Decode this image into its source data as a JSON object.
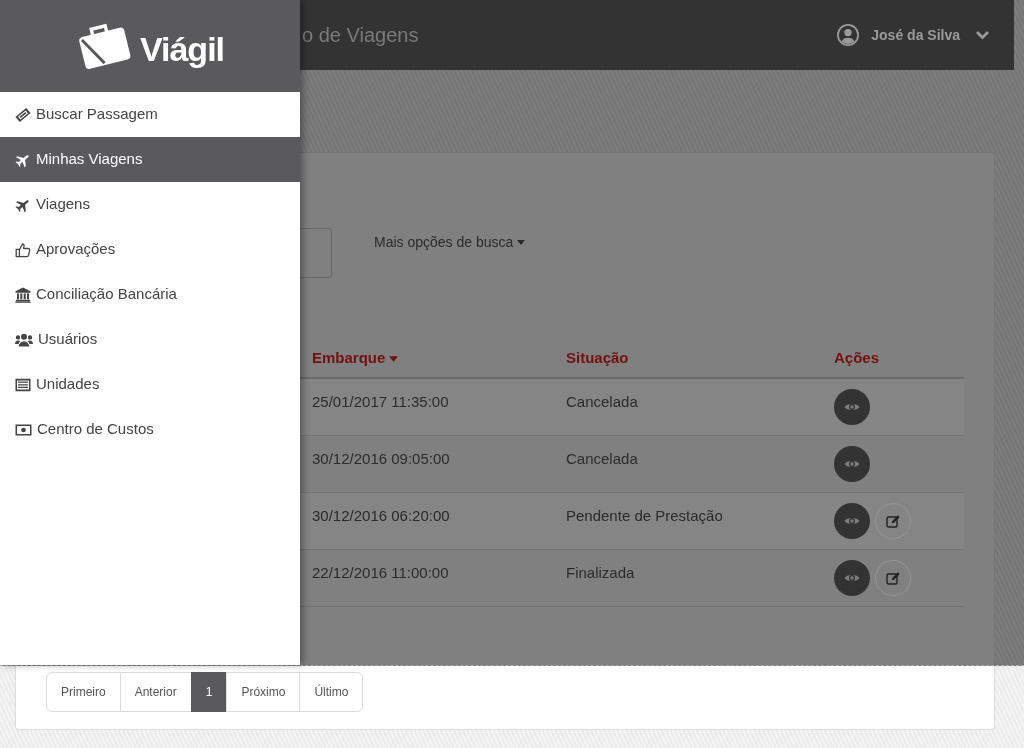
{
  "header": {
    "title": "o de Viagens",
    "user_name": "José da Silva"
  },
  "sidebar": {
    "logo": "Viágil",
    "items": [
      {
        "label": "Buscar Passagem",
        "selected": false
      },
      {
        "label": "Minhas Viagens",
        "selected": true
      },
      {
        "label": "Viagens",
        "selected": false
      },
      {
        "label": "Aprovações",
        "selected": false
      },
      {
        "label": "Conciliação Bancária",
        "selected": false
      },
      {
        "label": "Usuários",
        "selected": false
      },
      {
        "label": "Unidades",
        "selected": false
      },
      {
        "label": "Centro de Custos",
        "selected": false
      }
    ]
  },
  "search": {
    "more_options": "Mais opções de busca"
  },
  "table": {
    "columns": [
      {
        "label": "Embarque",
        "sorted": true
      },
      {
        "label": "Situação",
        "sorted": false
      },
      {
        "label": "Ações",
        "sorted": false
      }
    ],
    "rows": [
      {
        "embarque": "25/01/2017 11:35:00",
        "situacao": "Cancelada",
        "actions": [
          {
            "kind": "view"
          }
        ]
      },
      {
        "embarque": "30/12/2016 09:05:00",
        "situacao": "Cancelada",
        "actions": [
          {
            "kind": "view"
          }
        ]
      },
      {
        "embarque": "30/12/2016 06:20:00",
        "situacao": "Pendente de Prestação",
        "actions": [
          {
            "kind": "view"
          },
          {
            "kind": "edit"
          }
        ]
      },
      {
        "embarque": "22/12/2016 11:00:00",
        "situacao": "Finalizada",
        "actions": [
          {
            "kind": "view"
          },
          {
            "kind": "edit"
          }
        ]
      }
    ]
  },
  "pagination": {
    "items": [
      {
        "label": "Primeiro",
        "selected": false
      },
      {
        "label": "Anterior",
        "selected": false
      },
      {
        "label": "1",
        "selected": true
      },
      {
        "label": "Próximo",
        "selected": false
      },
      {
        "label": "Último",
        "selected": false
      }
    ]
  }
}
